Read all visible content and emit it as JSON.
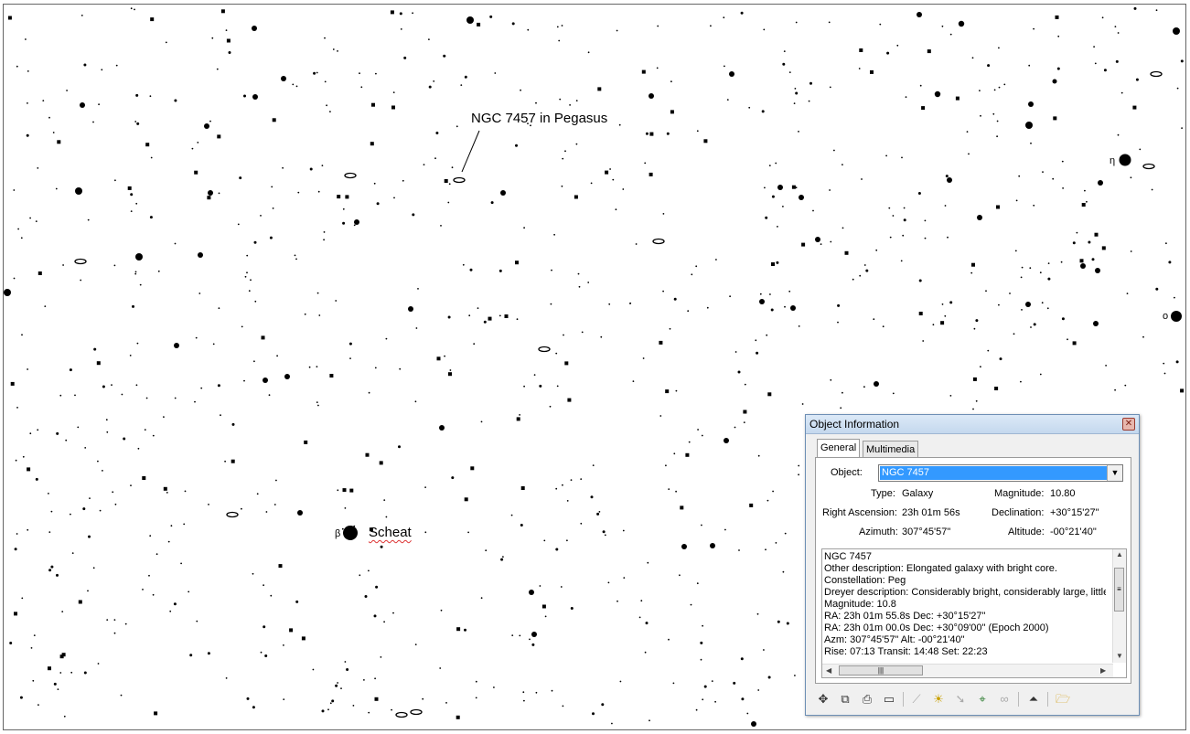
{
  "star_chart": {
    "labels": {
      "ngc": "NGC 7457 in Pegasus",
      "scheat": "Scheat",
      "beta": "β",
      "eta": "η",
      "omicron": "o"
    }
  },
  "dialog": {
    "title": "Object Information",
    "close": "✕",
    "tabs": [
      "General",
      "Multimedia"
    ],
    "fields": {
      "object_label": "Object:",
      "object_value": "NGC 7457",
      "type_label": "Type:",
      "type_value": "Galaxy",
      "magnitude_label": "Magnitude:",
      "magnitude_value": "10.80",
      "ra_label": "Right Ascension:",
      "ra_value": "23h 01m 56s",
      "dec_label": "Declination:",
      "dec_value": "+30°15'27\"",
      "azimuth_label": "Azimuth:",
      "azimuth_value": "307°45'57\"",
      "altitude_label": "Altitude:",
      "altitude_value": "-00°21'40\""
    },
    "description_lines": [
      "NGC 7457",
      "Other description: Elongated galaxy with bright core.",
      "Constellation:  Peg",
      "Dreyer description: Considerably bright, considerably large, little ex",
      "Magnitude: 10.8",
      "RA: 23h 01m 55.8s  Dec: +30°15'27\"",
      "RA: 23h 01m 00.0s  Dec: +30°09'00\"  (Epoch 2000)",
      "Azm: 307°45'57\"  Alt: -00°21'40\"",
      "Rise: 07:13  Transit: 14:48  Set: 22:23"
    ],
    "toolbar_icons": [
      "center-icon",
      "copy-icon",
      "print-icon",
      "book-icon",
      "telescope-icon",
      "landscape-icon",
      "slew-icon",
      "finder-icon",
      "link-icon",
      "collapse-icon",
      "open-folder-icon"
    ]
  }
}
